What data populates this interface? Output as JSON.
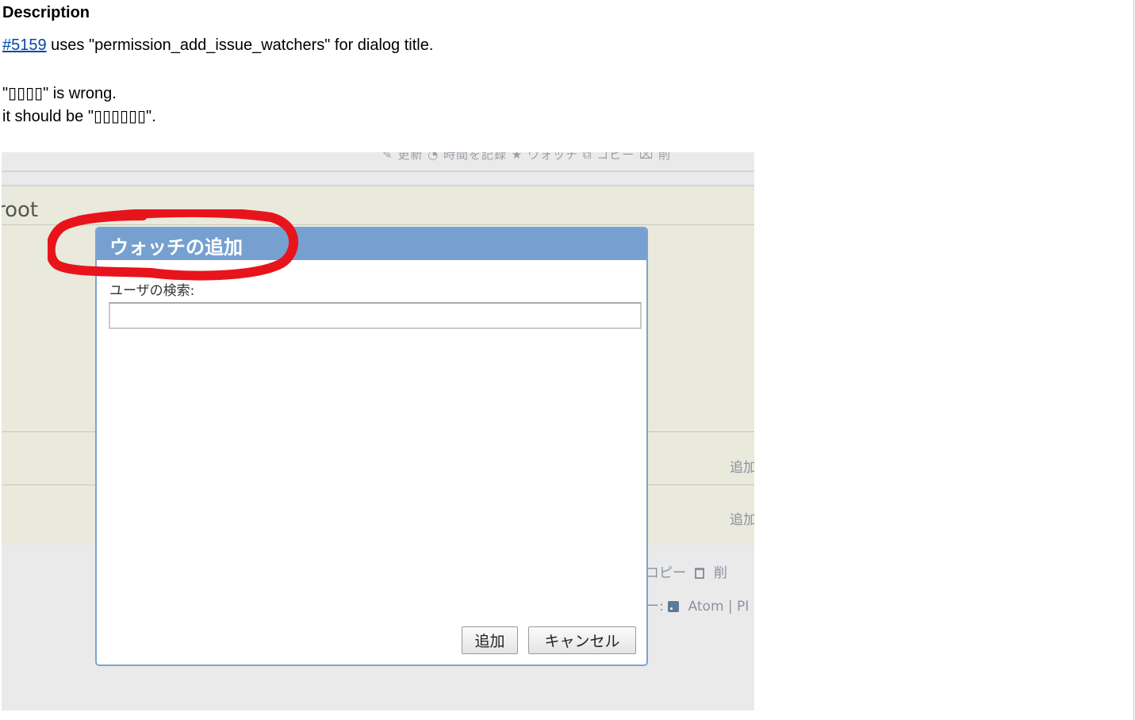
{
  "description": {
    "heading": "Description",
    "issue_link": "#5159",
    "line1_rest": " uses \"permission_add_issue_watchers\" for dialog title.",
    "line2": "\"▯▯▯▯\" is wrong.",
    "line3": "it should be \"▯▯▯▯▯▯\"."
  },
  "screenshot": {
    "toolbar_text": "✎ 更新  ◔ 時間を記録  ★ ウォッチ  ⧉ コピー  ⌧ 削",
    "project_fragment": "root",
    "side_add_1": "追加",
    "side_add_2": "追加",
    "side_copy": "コピー",
    "side_delete": "削",
    "side_feeds_prefix": "ー:",
    "side_feed_atom": "Atom",
    "side_feed_sep": "| PI",
    "dialog": {
      "title": "ウォッチの追加",
      "search_label": "ユーザの検索:",
      "search_value": "",
      "add_button": "追加",
      "cancel_button": "キャンセル"
    },
    "highlight_color": "#e8141c",
    "dialog_title_bg": "#76a0d0"
  }
}
